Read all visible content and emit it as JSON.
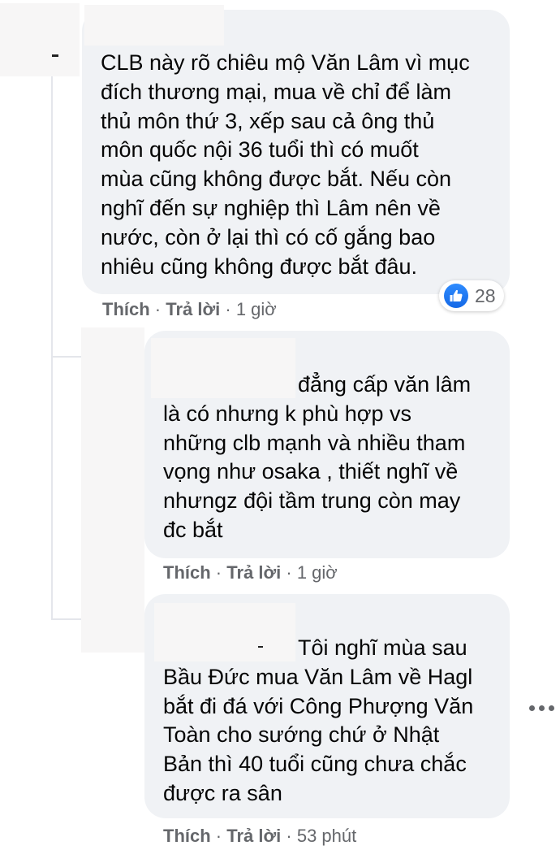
{
  "comments": [
    {
      "text": "CLB này rõ chiêu mộ Văn Lâm vì mục\nđích thương mại, mua về chỉ để làm\nthủ môn thứ 3, xếp sau cả ông thủ\nmôn quốc nội 36 tuổi thì có muốt\nmùa cũng không được bắt. Nếu còn\nnghĩ đến sự nghiệp thì Lâm nên về\nnước, còn ở lại thì có cố gắng bao\nnhiêu cũng không được bắt đâu.",
      "like": "Thích",
      "reply": "Trả lời",
      "time": "1 giờ",
      "reaction_count": "28"
    },
    {
      "text": "đẳng cấp văn lâm\nlà có nhưng k phù hợp vs\nnhững clb mạnh và nhiều tham\nvọng như osaka , thiết nghĩ về\nnhưngz đội tầm trung còn may\nđc bắt",
      "like": "Thích",
      "reply": "Trả lời",
      "time": "1 giờ"
    },
    {
      "text": "Tôi nghĩ mùa sau\nBầu Đức mua Văn Lâm về Hagl\nbắt đi đá với Công Phượng Văn\nToàn cho sướng chứ ở Nhật\nBản thì 40 tuổi cũng chưa chắc\nđược ra sân",
      "like": "Thích",
      "reply": "Trả lời",
      "time": "53 phút"
    }
  ],
  "separator": "·",
  "icons": {
    "reaction": "like-icon",
    "more": "more-options-icon"
  },
  "colors": {
    "bubble": "#f0f2f5",
    "meta_text": "#65676b",
    "like_blue": "#1877f2"
  }
}
